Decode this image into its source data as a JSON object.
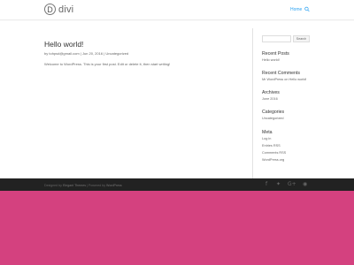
{
  "header": {
    "logo_letter": "D",
    "logo_text": "divi",
    "nav": {
      "home_label": "Home"
    }
  },
  "post": {
    "title": "Hello world!",
    "meta_prefix": "by",
    "author": "tohpsd@gmail.com",
    "separator1": "|",
    "date": "Jun 20, 2016",
    "separator2": "|",
    "category": "Uncategorized",
    "excerpt": "Welcome to WordPress. This is your first post. Edit or delete it, then start writing!"
  },
  "sidebar": {
    "search": {
      "value": "",
      "placeholder": "",
      "button_label": "Search"
    },
    "recent_posts": {
      "title": "Recent Posts",
      "items": [
        "Hello world!"
      ]
    },
    "recent_comments": {
      "title": "Recent Comments",
      "items": [
        "Mr WordPress on Hello world!"
      ]
    },
    "archives": {
      "title": "Archives",
      "items": [
        "June 2016"
      ]
    },
    "categories": {
      "title": "Categories",
      "items": [
        "Uncategorized"
      ]
    },
    "meta": {
      "title": "Meta",
      "items": [
        "Log in",
        "Entries RSS",
        "Comments RSS",
        "WordPress.org"
      ]
    }
  },
  "footer": {
    "credits_prefix": "Designed by",
    "designer": "Elegant Themes",
    "separator": "|",
    "powered_prefix": "Powered by",
    "platform": "WordPress",
    "social": [
      "facebook-icon",
      "twitter-icon",
      "google-plus-icon",
      "rss-icon"
    ],
    "social_glyphs": {
      "facebook": "f",
      "twitter": "✦",
      "google": "G+",
      "rss": "◉"
    }
  },
  "colors": {
    "accent": "#2ea3f2",
    "footer_background": "#222222",
    "page_background": "#d4417f"
  }
}
